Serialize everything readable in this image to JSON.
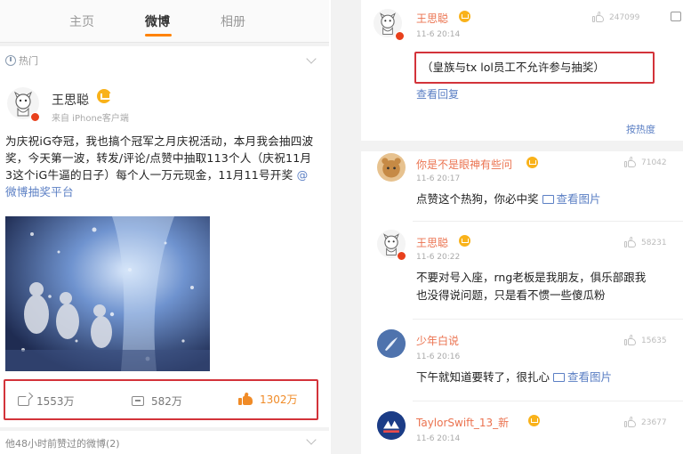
{
  "left": {
    "tabs": [
      "主页",
      "微博",
      "相册"
    ],
    "active_tab": 1,
    "section_label": "热门",
    "post": {
      "author": "王思聪",
      "source": "来自 iPhone客户端",
      "text": "为庆祝iG夺冠，我也搞个冠军之月庆祝活动，本月我会抽四波奖，今天第一波，转发/评论/点赞中抽取113个人（庆祝11月3这个iG牛逼的日子）每个人一万元现金，11月11号开奖 ",
      "link_text": "@微博抽奖平台",
      "reposts": "1553万",
      "comments": "582万",
      "likes": "1302万"
    },
    "bottom_label": "他48小时前赞过的微博(2)"
  },
  "right": {
    "top_comment": {
      "author": "王思聪",
      "time": "11-6 20:14",
      "likes": "247099",
      "text": "（皇族与tx lol员工不允许参与抽奖）",
      "reply_link": "查看回复"
    },
    "sort_label": "按热度",
    "comments": [
      {
        "author": "你是不是眼神有些问",
        "time": "11-6 20:17",
        "likes": "71042",
        "text": "点赞这个热狗，你必中奖",
        "image_link": "查看图片"
      },
      {
        "author": "王思聪",
        "time": "11-6 20:22",
        "likes": "58231",
        "text": "不要对号入座，rng老板是我朋友，俱乐部跟我也没得说问题，只是看不惯一些傻瓜粉"
      },
      {
        "author": "少年白说",
        "time": "11-6 20:16",
        "likes": "15635",
        "text": "下午就知道要转了，很扎心",
        "image_link": "查看图片"
      },
      {
        "author": "TaylorSwift_13_新",
        "time": "11-6 20:14",
        "likes": "23677"
      }
    ]
  },
  "colors": {
    "accent": "#ff8200",
    "highlight_border": "#d3333a",
    "name_orange": "#eb7350",
    "link_blue": "#5b7fc4",
    "like_orange": "#f08b27"
  }
}
